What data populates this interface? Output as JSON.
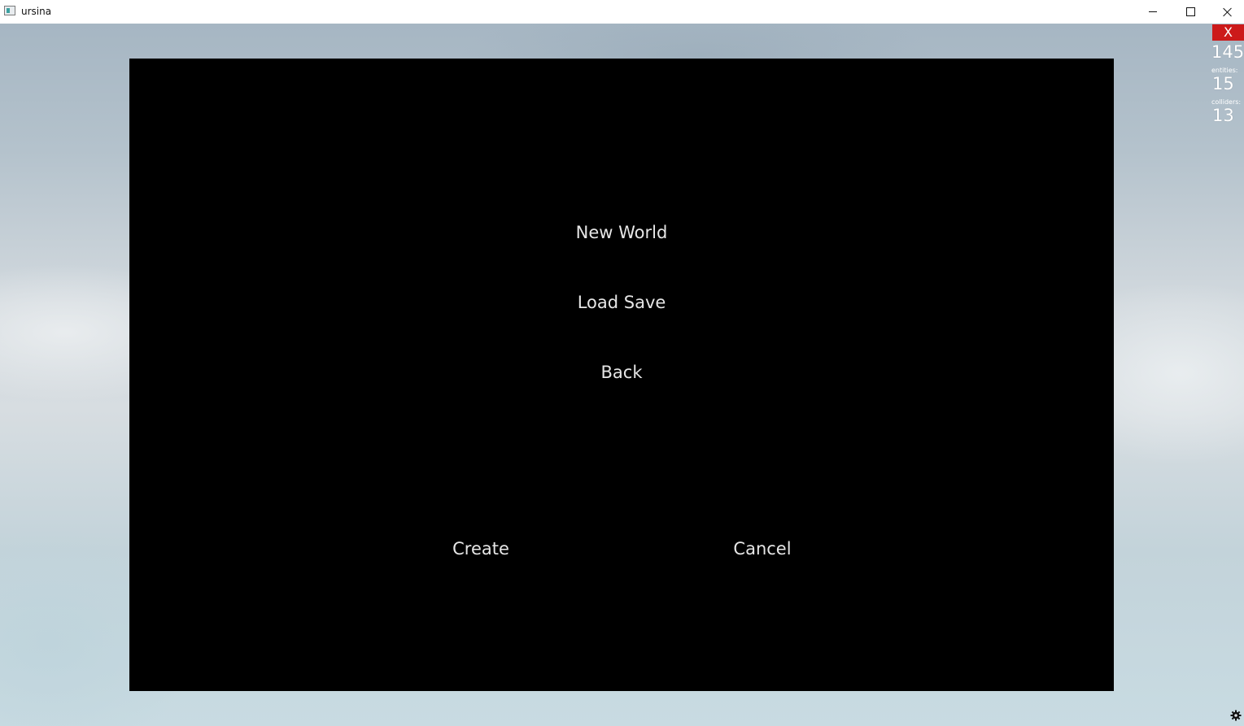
{
  "window": {
    "title": "ursina",
    "controls": {
      "minimize_icon": "minimize-icon",
      "maximize_icon": "maximize-icon",
      "close_icon": "close-icon"
    }
  },
  "menu": {
    "new_world": "New World",
    "load_save": "Load Save",
    "back": "Back",
    "create": "Create",
    "cancel": "Cancel"
  },
  "debug_overlay": {
    "exit_label": "X",
    "fps": "145",
    "entities_label": "entities:",
    "entities": "15",
    "colliders_label": "colliders:",
    "colliders": "13",
    "settings_icon": "gear-icon"
  },
  "colors": {
    "panel_background": "#000000",
    "menu_text": "#e6e6e6",
    "exit_button": "#cc1a1a",
    "overlay_text": "#ffffff"
  }
}
